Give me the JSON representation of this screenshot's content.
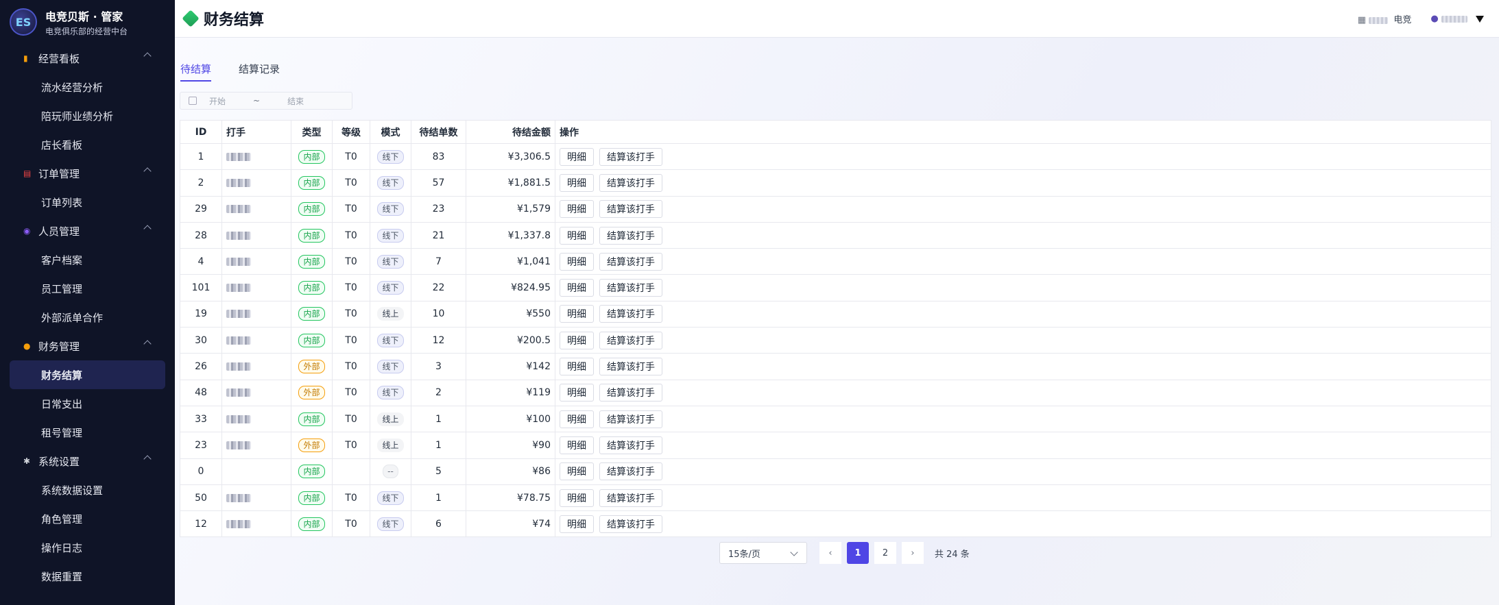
{
  "brand": {
    "title": "电竞贝斯 · 管家",
    "subtitle": "电竞俱乐部的经营中台",
    "logo_text": "ES"
  },
  "sidebar": {
    "groups": [
      {
        "label": "经营看板",
        "icon": "chart-icon",
        "items": [
          "流水经营分析",
          "陪玩师业绩分析",
          "店长看板"
        ]
      },
      {
        "label": "订单管理",
        "icon": "clipboard-icon",
        "items": [
          "订单列表"
        ]
      },
      {
        "label": "人员管理",
        "icon": "people-icon",
        "items": [
          "客户档案",
          "员工管理",
          "外部派单合作"
        ]
      },
      {
        "label": "财务管理",
        "icon": "moneybag-icon",
        "items": [
          "财务结算",
          "日常支出",
          "租号管理"
        ]
      },
      {
        "label": "系统设置",
        "icon": "gear-icon",
        "items": [
          "系统数据设置",
          "角色管理",
          "操作日志",
          "数据重置"
        ]
      }
    ],
    "active_item": "财务结算"
  },
  "header": {
    "title": "财务结算",
    "org_label": "电竞"
  },
  "tabs": [
    "待结算",
    "结算记录"
  ],
  "date_range": {
    "start_placeholder": "开始",
    "separator": "~",
    "end_placeholder": "结束"
  },
  "table": {
    "headers": {
      "id": "ID",
      "player": "打手",
      "type": "类型",
      "level": "等级",
      "mode": "模式",
      "count": "待结单数",
      "amount": "待结金额",
      "ops": "操作"
    },
    "actions": {
      "detail": "明细",
      "settle": "结算该打手"
    },
    "rows": [
      {
        "id": "1",
        "type": "内部",
        "level": "T0",
        "mode": "线下",
        "count": "83",
        "amount": "¥3,306.5"
      },
      {
        "id": "2",
        "type": "内部",
        "level": "T0",
        "mode": "线下",
        "count": "57",
        "amount": "¥1,881.5"
      },
      {
        "id": "29",
        "type": "内部",
        "level": "T0",
        "mode": "线下",
        "count": "23",
        "amount": "¥1,579"
      },
      {
        "id": "28",
        "type": "内部",
        "level": "T0",
        "mode": "线下",
        "count": "21",
        "amount": "¥1,337.8"
      },
      {
        "id": "4",
        "type": "内部",
        "level": "T0",
        "mode": "线下",
        "count": "7",
        "amount": "¥1,041"
      },
      {
        "id": "101",
        "type": "内部",
        "level": "T0",
        "mode": "线下",
        "count": "22",
        "amount": "¥824.95"
      },
      {
        "id": "19",
        "type": "内部",
        "level": "T0",
        "mode": "线上",
        "count": "10",
        "amount": "¥550"
      },
      {
        "id": "30",
        "type": "内部",
        "level": "T0",
        "mode": "线下",
        "count": "12",
        "amount": "¥200.5"
      },
      {
        "id": "26",
        "type": "外部",
        "level": "T0",
        "mode": "线下",
        "count": "3",
        "amount": "¥142"
      },
      {
        "id": "48",
        "type": "外部",
        "level": "T0",
        "mode": "线下",
        "count": "2",
        "amount": "¥119"
      },
      {
        "id": "33",
        "type": "内部",
        "level": "T0",
        "mode": "线上",
        "count": "1",
        "amount": "¥100"
      },
      {
        "id": "23",
        "type": "外部",
        "level": "T0",
        "mode": "线上",
        "count": "1",
        "amount": "¥90"
      },
      {
        "id": "0",
        "type": "内部",
        "level": "",
        "mode": "--",
        "count": "5",
        "amount": "¥86"
      },
      {
        "id": "50",
        "type": "内部",
        "level": "T0",
        "mode": "线下",
        "count": "1",
        "amount": "¥78.75"
      },
      {
        "id": "12",
        "type": "内部",
        "level": "T0",
        "mode": "线下",
        "count": "6",
        "amount": "¥74"
      }
    ]
  },
  "pagination": {
    "page_size": "15条/页",
    "pages": [
      "1",
      "2"
    ],
    "current": "1",
    "total": "共 24 条",
    "prev": "‹",
    "next": "›"
  },
  "colors": {
    "accent": "#4f46e5",
    "sidebar_bg": "#0f1427",
    "tag_internal": "#22c55e",
    "tag_external": "#f59e0b"
  }
}
